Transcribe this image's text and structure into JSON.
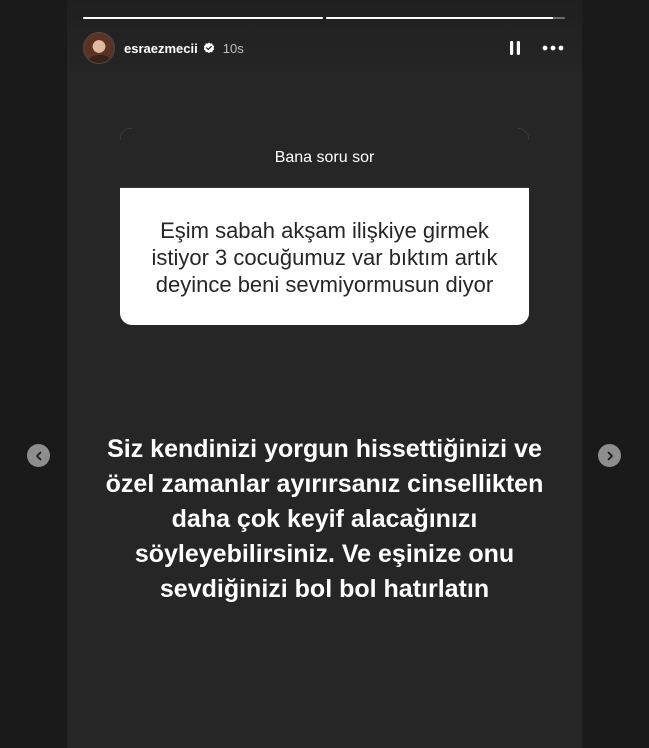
{
  "story": {
    "progress": [
      1.0,
      0.95
    ],
    "header": {
      "username": "esraezmecii",
      "verified": true,
      "time": "10s",
      "icons": {
        "avatar": "avatar",
        "verified": "verified-badge-icon",
        "pause": "pause-icon",
        "more": "more-icon"
      }
    },
    "question_sticker": {
      "title": "Bana soru sor",
      "question": "Eşim sabah akşam ilişkiye girmek istiyor 3 cocuğumuz var bıktım artık deyince beni sevmiyormusun diyor"
    },
    "answer": "Siz kendinizi yorgun hissettiğinizi ve özel zamanlar ayırırsanız cinsellikten daha çok keyif alacağınızı söyleyebilirsiniz. Ve eşinize onu sevdiğinizi bol bol hatırlatın"
  },
  "navigation": {
    "prev_icon": "chevron-left-icon",
    "next_icon": "chevron-right-icon"
  },
  "colors": {
    "background": "#1a1a1a",
    "story_background": "#262626",
    "card_header": "#262626",
    "card_body": "#ffffff",
    "text_light": "#ffffff",
    "text_dark": "#262626",
    "nav_button": "#8e8e8e"
  }
}
